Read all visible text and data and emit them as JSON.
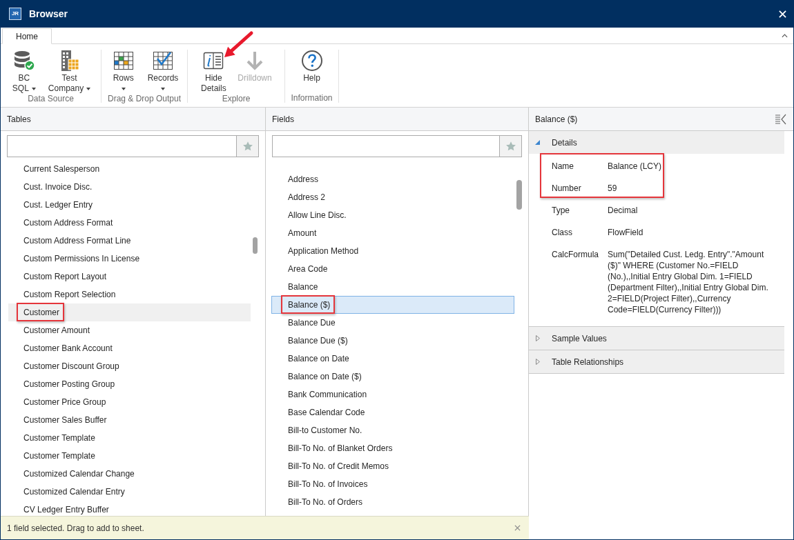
{
  "window": {
    "title": "Browser",
    "logo_text": "JR"
  },
  "ribbon": {
    "tabs": [
      {
        "label": "Home",
        "selected": true
      }
    ],
    "groups": [
      {
        "label": "Data Source",
        "buttons": [
          {
            "kind": "database",
            "label_lines": [
              "BC",
              "SQL"
            ],
            "dropdown": true,
            "disabled": false,
            "pointed_at": false
          },
          {
            "kind": "company",
            "label_lines": [
              "Test",
              "Company"
            ],
            "dropdown": true,
            "disabled": false,
            "pointed_at": false
          }
        ]
      },
      {
        "label": "Drag & Drop Output",
        "buttons": [
          {
            "kind": "rows",
            "label_lines": [
              "Rows"
            ],
            "dropdown": true,
            "disabled": false,
            "pointed_at": false
          },
          {
            "kind": "records",
            "label_lines": [
              "Records"
            ],
            "dropdown": true,
            "disabled": false,
            "pointed_at": false
          }
        ]
      },
      {
        "label": "Explore",
        "buttons": [
          {
            "kind": "details",
            "label_lines": [
              "Hide",
              "Details"
            ],
            "dropdown": false,
            "disabled": false,
            "pointed_at": true
          },
          {
            "kind": "drilldown",
            "label_lines": [
              "Drilldown"
            ],
            "dropdown": false,
            "disabled": true,
            "pointed_at": false
          }
        ]
      },
      {
        "label": "Information",
        "buttons": [
          {
            "kind": "help",
            "label_lines": [
              "Help"
            ],
            "dropdown": false,
            "disabled": false,
            "pointed_at": false
          }
        ]
      }
    ]
  },
  "tables": {
    "title": "Tables",
    "focused": false,
    "items": [
      {
        "label": "Current Salesperson",
        "selected": false,
        "highlighted": false
      },
      {
        "label": "Cust. Invoice Disc.",
        "selected": false,
        "highlighted": false
      },
      {
        "label": "Cust. Ledger Entry",
        "selected": false,
        "highlighted": false
      },
      {
        "label": "Custom Address Format",
        "selected": false,
        "highlighted": false
      },
      {
        "label": "Custom Address Format Line",
        "selected": false,
        "highlighted": false
      },
      {
        "label": "Custom Permissions In License",
        "selected": false,
        "highlighted": false
      },
      {
        "label": "Custom Report Layout",
        "selected": false,
        "highlighted": false
      },
      {
        "label": "Custom Report Selection",
        "selected": false,
        "highlighted": false
      },
      {
        "label": "Customer",
        "selected": true,
        "highlighted": true
      },
      {
        "label": "Customer Amount",
        "selected": false,
        "highlighted": false
      },
      {
        "label": "Customer Bank Account",
        "selected": false,
        "highlighted": false
      },
      {
        "label": "Customer Discount Group",
        "selected": false,
        "highlighted": false
      },
      {
        "label": "Customer Posting Group",
        "selected": false,
        "highlighted": false
      },
      {
        "label": "Customer Price Group",
        "selected": false,
        "highlighted": false
      },
      {
        "label": "Customer Sales Buffer",
        "selected": false,
        "highlighted": false
      },
      {
        "label": "Customer Template",
        "selected": false,
        "highlighted": false
      },
      {
        "label": "Customer Template",
        "selected": false,
        "highlighted": false
      },
      {
        "label": "Customized Calendar Change",
        "selected": false,
        "highlighted": false
      },
      {
        "label": "Customized Calendar Entry",
        "selected": false,
        "highlighted": false
      },
      {
        "label": "CV Ledger Entry Buffer",
        "selected": false,
        "highlighted": false
      }
    ]
  },
  "fields": {
    "title": "Fields",
    "focused": true,
    "items": [
      {
        "label": "Address",
        "selected": false,
        "highlighted": false
      },
      {
        "label": "Address 2",
        "selected": false,
        "highlighted": false
      },
      {
        "label": "Allow Line Disc.",
        "selected": false,
        "highlighted": false
      },
      {
        "label": "Amount",
        "selected": false,
        "highlighted": false
      },
      {
        "label": "Application Method",
        "selected": false,
        "highlighted": false
      },
      {
        "label": "Area Code",
        "selected": false,
        "highlighted": false
      },
      {
        "label": "Balance",
        "selected": false,
        "highlighted": false
      },
      {
        "label": "Balance ($)",
        "selected": true,
        "highlighted": true
      },
      {
        "label": "Balance Due",
        "selected": false,
        "highlighted": false
      },
      {
        "label": "Balance Due ($)",
        "selected": false,
        "highlighted": false
      },
      {
        "label": "Balance on Date",
        "selected": false,
        "highlighted": false
      },
      {
        "label": "Balance on Date ($)",
        "selected": false,
        "highlighted": false
      },
      {
        "label": "Bank Communication",
        "selected": false,
        "highlighted": false
      },
      {
        "label": "Base Calendar Code",
        "selected": false,
        "highlighted": false
      },
      {
        "label": "Bill-to Customer No.",
        "selected": false,
        "highlighted": false
      },
      {
        "label": "Bill-To No. of Blanket Orders",
        "selected": false,
        "highlighted": false
      },
      {
        "label": "Bill-To No. of Credit Memos",
        "selected": false,
        "highlighted": false
      },
      {
        "label": "Bill-To No. of Invoices",
        "selected": false,
        "highlighted": false
      },
      {
        "label": "Bill-To No. of Orders",
        "selected": false,
        "highlighted": false
      }
    ]
  },
  "details": {
    "title": "Balance ($)",
    "sections": [
      {
        "label": "Details",
        "expanded": true,
        "properties": [
          {
            "name": "Name",
            "value": "Balance (LCY)",
            "highlighted": true
          },
          {
            "name": "Number",
            "value": "59",
            "highlighted": true
          },
          {
            "name": "Type",
            "value": "Decimal",
            "highlighted": false
          },
          {
            "name": "Class",
            "value": "FlowField",
            "highlighted": false
          },
          {
            "name": "CalcFormula",
            "value": "Sum(\"Detailed Cust. Ledg. Entry\".\"Amount ($)\" WHERE (Customer No.=FIELD (No.),,Initial Entry Global Dim. 1=FIELD (Department Filter),,Initial Entry Global Dim. 2=FIELD(Project Filter),,Currency Code=FIELD(Currency Filter)))",
            "highlighted": false
          }
        ]
      },
      {
        "label": "Sample Values",
        "expanded": false
      },
      {
        "label": "Table Relationships",
        "expanded": false
      }
    ]
  },
  "status_bar": {
    "message": "1 field selected. Drag to add to sheet."
  }
}
